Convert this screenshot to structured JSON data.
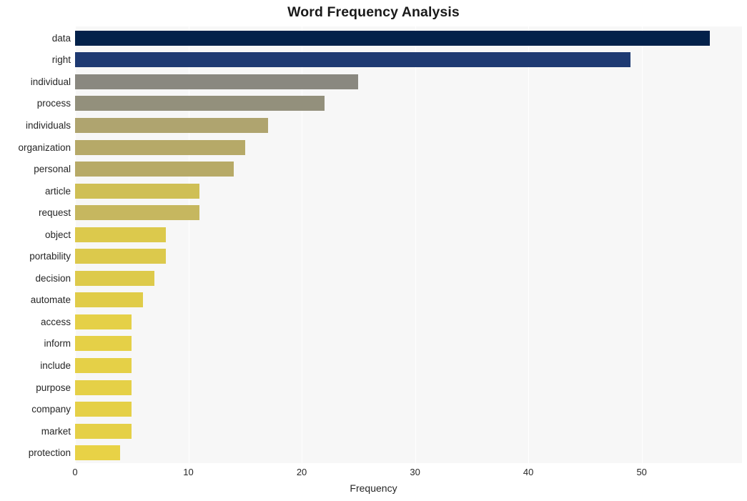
{
  "chart_data": {
    "type": "bar",
    "orientation": "horizontal",
    "title": "Word Frequency Analysis",
    "xlabel": "Frequency",
    "ylabel": "",
    "xlim": [
      0,
      58.85
    ],
    "xticks": [
      0,
      10,
      20,
      30,
      40,
      50
    ],
    "xtick_labels": [
      "0",
      "10",
      "20",
      "30",
      "40",
      "50"
    ],
    "grid": true,
    "grid_axis": "x",
    "legend": null,
    "plot_background": "#f7f7f7",
    "figure_background": "#ffffff",
    "categories": [
      "data",
      "right",
      "individual",
      "process",
      "individuals",
      "organization",
      "personal",
      "article",
      "request",
      "object",
      "portability",
      "decision",
      "automate",
      "access",
      "inform",
      "include",
      "purpose",
      "company",
      "market",
      "protection"
    ],
    "values": [
      56,
      49,
      25,
      22,
      17,
      15,
      14,
      11,
      11,
      8,
      8,
      7,
      6,
      5,
      5,
      5,
      5,
      5,
      5,
      4
    ],
    "bar_colors": [
      "#03214a",
      "#1e3a72",
      "#8a8880",
      "#93907c",
      "#afa46f",
      "#b6a968",
      "#b7aa67",
      "#cfbf55",
      "#c6b75f",
      "#dcc94c",
      "#dcc94c",
      "#ddca4b",
      "#e0cc49",
      "#e5d047",
      "#e5d047",
      "#e5d047",
      "#e5d047",
      "#e5d047",
      "#e5d047",
      "#e8d246"
    ]
  }
}
